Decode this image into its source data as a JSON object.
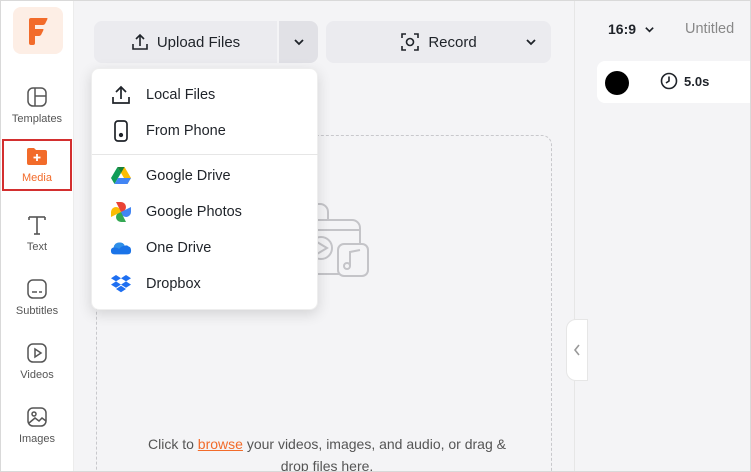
{
  "sidebar": {
    "items": [
      {
        "label": "Templates",
        "icon": "templates-icon"
      },
      {
        "label": "Media",
        "icon": "media-icon",
        "active": true
      },
      {
        "label": "Text",
        "icon": "text-icon"
      },
      {
        "label": "Subtitles",
        "icon": "subtitles-icon"
      },
      {
        "label": "Videos",
        "icon": "videos-icon"
      },
      {
        "label": "Images",
        "icon": "images-icon"
      }
    ]
  },
  "toolbar": {
    "upload_label": "Upload Files",
    "record_label": "Record"
  },
  "upload_menu": {
    "items": [
      {
        "label": "Local Files",
        "icon": "upload-icon"
      },
      {
        "label": "From Phone",
        "icon": "phone-icon"
      },
      {
        "label": "Google Drive",
        "icon": "google-drive-icon"
      },
      {
        "label": "Google Photos",
        "icon": "google-photos-icon"
      },
      {
        "label": "One Drive",
        "icon": "onedrive-icon"
      },
      {
        "label": "Dropbox",
        "icon": "dropbox-icon"
      }
    ]
  },
  "dropzone": {
    "text_before": "Click to ",
    "link": "browse",
    "text_after": " your videos, images, and audio, or drag & drop files here."
  },
  "right_panel": {
    "aspect_ratio": "16:9",
    "project_title": "Untitled",
    "scene_duration": "5.0s",
    "scene_color": "#000000"
  },
  "colors": {
    "accent": "#f26b2a",
    "active_border": "#d32f2f"
  }
}
